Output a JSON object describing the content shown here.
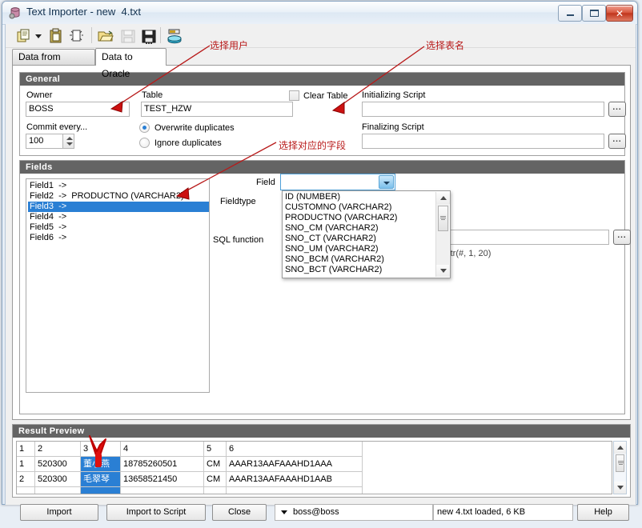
{
  "window": {
    "title": "Text Importer - new  4.txt",
    "icon": "database-icon",
    "minimize_label": "Minimize",
    "maximize_label": "Maximize",
    "close_label": "Close"
  },
  "toolbar": {
    "items": [
      {
        "name": "copy-icon",
        "label": "Copy"
      },
      {
        "name": "dropdown-arrow-icon",
        "label": "More"
      },
      {
        "name": "paste-icon",
        "label": "Paste"
      },
      {
        "name": "new-document-icon",
        "label": "New"
      },
      {
        "name": "open-folder-icon",
        "label": "Open"
      },
      {
        "name": "save-icon",
        "label": "Save"
      },
      {
        "name": "save-as-icon",
        "label": "Save As"
      },
      {
        "name": "database-import-icon",
        "label": "Import"
      }
    ]
  },
  "tabs": [
    {
      "label": "Data from Textfile",
      "active": false
    },
    {
      "label": "Data to Oracle",
      "active": true
    }
  ],
  "general": {
    "title": "General",
    "owner_label": "Owner",
    "owner_value": "BOSS",
    "table_label": "Table",
    "table_value": "TEST_HZW",
    "clear_table_label": "Clear Table",
    "clear_table_checked": false,
    "commit_label": "Commit every...",
    "commit_value": "100",
    "duplicates": [
      {
        "label": "Overwrite duplicates",
        "selected": true
      },
      {
        "label": "Ignore duplicates",
        "selected": false
      }
    ],
    "init_script_label": "Initializing Script",
    "init_script_value": "",
    "final_script_label": "Finalizing Script",
    "final_script_value": "",
    "browse_label": "..."
  },
  "fields": {
    "title": "Fields",
    "list": [
      {
        "label": "Field1  ->",
        "selected": false
      },
      {
        "label": "Field2  ->  PRODUCTNO (VARCHAR2)",
        "selected": false
      },
      {
        "label": "Field3  ->",
        "selected": true
      },
      {
        "label": "Field4  ->",
        "selected": false
      },
      {
        "label": "Field5  ->",
        "selected": false
      },
      {
        "label": "Field6  ->",
        "selected": false
      }
    ],
    "field_label": "Field",
    "field_value": "",
    "fieldtype_label": "Fieldtype",
    "sql_function_label": "SQL function",
    "sql_function_value": "",
    "sql_hint": "bstr(#, 1, 20)",
    "browse_label": "...",
    "dropdown_options": [
      "ID (NUMBER)",
      "CUSTOMNO (VARCHAR2)",
      "PRODUCTNO (VARCHAR2)",
      "SNO_CM (VARCHAR2)",
      "SNO_CT (VARCHAR2)",
      "SNO_UM (VARCHAR2)",
      "SNO_BCM (VARCHAR2)",
      "SNO_BCT (VARCHAR2)"
    ]
  },
  "preview": {
    "title": "Result Preview",
    "columns": [
      "1",
      "2",
      "3",
      "4",
      "5",
      "6"
    ],
    "rows": [
      {
        "cells": [
          "1",
          "520300",
          "董小燕",
          "18785260501",
          "CM",
          "AAAR13AAFAAAHD1AAA"
        ],
        "selected_col": 2
      },
      {
        "cells": [
          "2",
          "520300",
          "毛翠琴",
          "13658521450",
          "CM",
          "AAAR13AAFAAAHD1AAB"
        ],
        "selected_col": 2
      }
    ]
  },
  "bottom": {
    "import_label": "Import",
    "import_script_label": "Import to Script",
    "close_label": "Close",
    "connection": "boss@boss",
    "status": "new  4.txt loaded,  6 KB",
    "help_label": "Help"
  },
  "annotations": [
    {
      "text": "选择用户",
      "name": "annotation-select-user"
    },
    {
      "text": "选择表名",
      "name": "annotation-select-table"
    },
    {
      "text": "选择对应的字段",
      "name": "annotation-select-field"
    }
  ],
  "colors": {
    "annotation": "#b81a1a",
    "selection": "#2a7fd4",
    "group_header": "#646464",
    "close_button": "#c1351c"
  }
}
